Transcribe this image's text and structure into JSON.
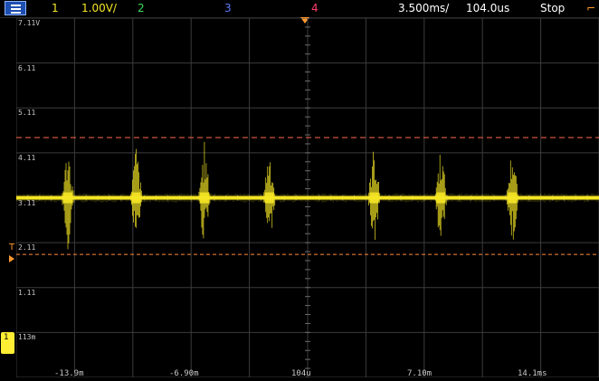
{
  "topbar": {
    "ch1": "1",
    "ch1_scale": "1.00V/",
    "ch2": "2",
    "ch3": "3",
    "ch4": "4",
    "timebase": "3.500ms/",
    "delay": "104.0us",
    "run_state": "Stop",
    "trigger_symbol": "⌐"
  },
  "colors": {
    "ch1": "#f5e625",
    "ch2": "#3ddc5a",
    "ch3": "#5f7bff",
    "ch4": "#ff3b6a",
    "grid": "#3c3c3c",
    "cursor": "#ff6a4a",
    "trigger": "#ff9a2e"
  },
  "screen": {
    "y_labels": [
      "7.11V",
      "6.11",
      "5.11",
      "4.11",
      "3.11",
      "2.11",
      "1.11",
      "113m"
    ],
    "x_labels": [
      "-13.9m",
      "-6.90m",
      "104u",
      "7.10m",
      "14.1ms"
    ],
    "trigger_marker": "T",
    "channel_marker": "1"
  },
  "chart_data": {
    "type": "line",
    "baseline": 3.11,
    "upper_cursor": 4.45,
    "lower_cursor": 1.85,
    "burst_times_ms": [
      -14.3,
      -10.2,
      -6.1,
      -2.2,
      4.1,
      8.1,
      12.4
    ],
    "xlim": [
      -17.4,
      17.6
    ],
    "ylim": [
      -0.887,
      7.11
    ]
  }
}
